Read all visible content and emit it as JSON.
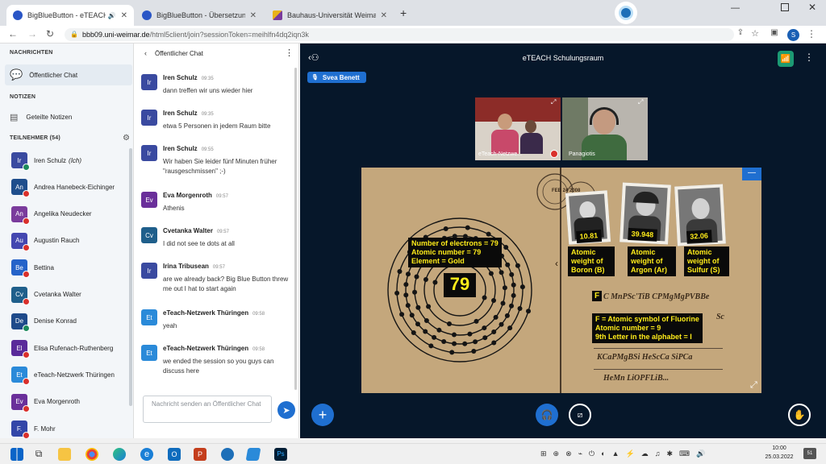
{
  "browser": {
    "tabs": [
      {
        "title": "BigBlueButton - eTEACH Sch",
        "active": true
      },
      {
        "title": "BigBlueButton - Übersetzungsra",
        "active": false
      },
      {
        "title": "Bauhaus-Universität Weimar: Co",
        "active": false
      }
    ],
    "new_tab": "+",
    "url_host": "bbb09.uni-weimar.de",
    "url_path": "/html5client/join?sessionToken=meihlfn4dq2iqn3k",
    "profile_initial": "S"
  },
  "nav": {
    "messages_heading": "NACHRICHTEN",
    "public_chat": "Öffentlicher Chat",
    "notes_heading": "NOTIZEN",
    "shared_notes": "Geteilte Notizen",
    "participants_heading": "TEILNEHMER (54)",
    "participants": [
      {
        "initials": "Ir",
        "name": "Iren Schulz",
        "suffix": "(Ich)",
        "color": "#3a4aa0",
        "mic": "#1d8a5c"
      },
      {
        "initials": "An",
        "name": "Andrea Hanebeck-Eichinger",
        "color": "#1f4e8c",
        "mic": "#d9302c"
      },
      {
        "initials": "An",
        "name": "Angelika Neudecker",
        "color": "#7a3b9c",
        "mic": "#d9302c"
      },
      {
        "initials": "Au",
        "name": "Augustin Rauch",
        "color": "#4447b0",
        "mic": "#d9302c"
      },
      {
        "initials": "Be",
        "name": "Bettina",
        "color": "#2563c9",
        "mic": "#d9302c"
      },
      {
        "initials": "Cv",
        "name": "Cvetanka Walter",
        "color": "#1f5f8b",
        "mic": "#d9302c"
      },
      {
        "initials": "De",
        "name": "Denise Konrad",
        "color": "#1e4a8a",
        "mic": "#1d8a5c"
      },
      {
        "initials": "El",
        "name": "Elisa Rufenach-Ruthenberg",
        "color": "#5a2a9a",
        "mic": "#d9302c"
      },
      {
        "initials": "Et",
        "name": "eTeach-Netzwerk Thüringen",
        "color": "#2a8ad9",
        "mic": "#d9302c"
      },
      {
        "initials": "Ev",
        "name": "Eva Morgenroth",
        "color": "#6a2f9a",
        "mic": "#d9302c"
      },
      {
        "initials": "F.",
        "name": "F. Mohr",
        "color": "#3346a8",
        "mic": "#d9302c"
      }
    ]
  },
  "chat": {
    "title": "Öffentlicher Chat",
    "messages": [
      {
        "initials": "Ir",
        "name": "Iren Schulz",
        "time": "09:35",
        "text": "dann treffen wir uns wieder hier",
        "color": "#3a4aa0"
      },
      {
        "initials": "Ir",
        "name": "Iren Schulz",
        "time": "09:35",
        "text": "etwa 5 Personen in jedem Raum bitte",
        "color": "#3a4aa0"
      },
      {
        "initials": "Ir",
        "name": "Iren Schulz",
        "time": "09:55",
        "text": "Wir haben Sie leider fünf Minuten früher \"rausgeschmissen\" ;-)",
        "color": "#3a4aa0"
      },
      {
        "initials": "Ev",
        "name": "Eva Morgenroth",
        "time": "09:57",
        "text": "Athenis",
        "color": "#6a2f9a"
      },
      {
        "initials": "Cv",
        "name": "Cvetanka Walter",
        "time": "09:57",
        "text": "I did not see te dots at all",
        "color": "#1f5f8b"
      },
      {
        "initials": "Ir",
        "name": "Irina Tribusean",
        "time": "09:57",
        "text": "are we already back? Big Blue Button threw me out I hat to start again",
        "color": "#3a4aa0"
      },
      {
        "initials": "Et",
        "name": "eTeach-Netzwerk Thüringen",
        "time": "09:58",
        "text": "yeah",
        "color": "#2a8ad9"
      },
      {
        "initials": "Et",
        "name": "eTeach-Netzwerk Thüringen",
        "time": "09:58",
        "text": "we ended the session so you guys can discuss here",
        "color": "#2a8ad9"
      }
    ],
    "input_placeholder": "Nachricht senden an Öffentlicher Chat"
  },
  "meeting": {
    "title": "eTEACH Schulungsraum",
    "talker": "Svea Benett",
    "video1_label": "eTeach-Netzwe...",
    "video2_label": "Panagiotis"
  },
  "slide": {
    "atomic_number_big": "79",
    "gold_label": [
      "Number of electrons = 79",
      "Atomic number = 79",
      "Element = Gold"
    ],
    "stamp_values": [
      "10.81",
      "39.948",
      "32.06"
    ],
    "weights": [
      [
        "Atomic",
        "weight of",
        "Boron (B)"
      ],
      [
        "Atomic",
        "weight of",
        "Argon (Ar)"
      ],
      [
        "Atomic",
        "weight of",
        "Sulfur (S)"
      ]
    ],
    "f_letter": "F",
    "formula1": "C MnPSc'TiB CPMgMgPVBBe",
    "formula_side": "Sc",
    "fluorine": [
      "F = Atomic symbol of Fluorine",
      "Atomic number = 9",
      "9th Letter in the alphabet = I"
    ],
    "formula2": "KCaPMgBSi HeScCa SiPCa",
    "formula3": "HeMn LiOPFLiB...",
    "postmark": "FEB 24 2008"
  },
  "taskbar": {
    "time": "10:00",
    "date": "25.03.2022",
    "notifications": "51"
  }
}
